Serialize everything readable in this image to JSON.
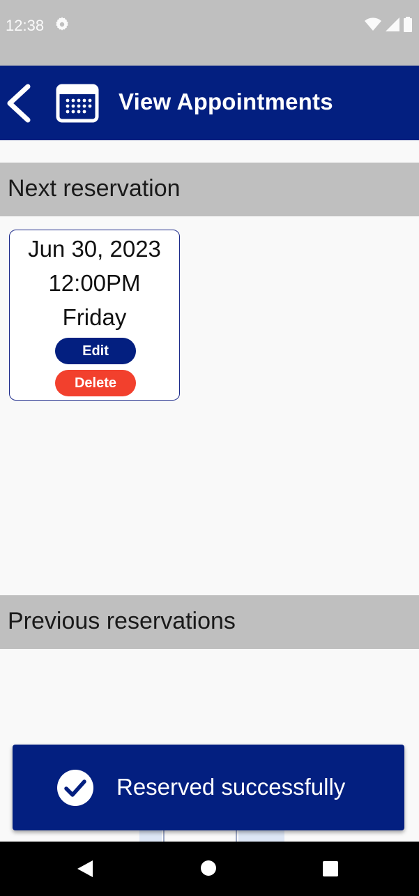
{
  "status_bar": {
    "time": "12:38",
    "icons": [
      "gear-icon",
      "wifi-icon",
      "signal-icon",
      "battery-icon"
    ]
  },
  "app_bar": {
    "title": "View Appointments",
    "color": "#031f80"
  },
  "next_reservation": {
    "header": "Next reservation",
    "card": {
      "date": "Jun 30, 2023",
      "time": "12:00PM",
      "day": "Friday",
      "edit_label": "Edit",
      "delete_label": "Delete"
    }
  },
  "previous_reservations": {
    "header": "Previous reservations"
  },
  "snackbar": {
    "message": "Reserved successfully",
    "icon": "check-circle-icon"
  },
  "colors": {
    "primary": "#031f80",
    "danger": "#f2402d",
    "section_bg": "#bfbfbf"
  }
}
